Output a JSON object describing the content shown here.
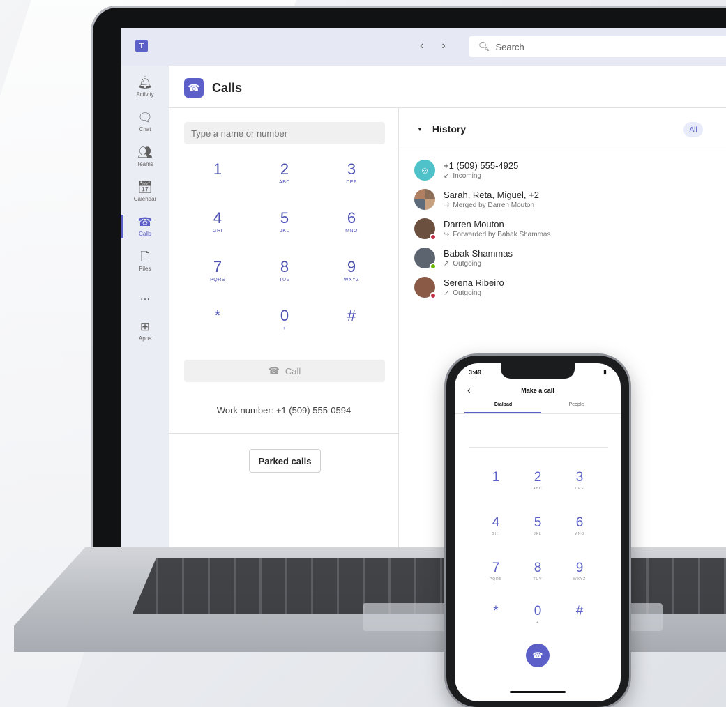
{
  "colors": {
    "brand": "#5b5fc7",
    "presence_busy": "#c4314b",
    "presence_available": "#6bb700"
  },
  "titlebar": {
    "back_icon": "chevron-left-icon",
    "forward_icon": "chevron-right-icon",
    "search_placeholder": "Search"
  },
  "rail": {
    "items": [
      {
        "label": "Activity",
        "icon": "bell-icon"
      },
      {
        "label": "Chat",
        "icon": "chat-icon"
      },
      {
        "label": "Teams",
        "icon": "teams-icon"
      },
      {
        "label": "Calendar",
        "icon": "calendar-icon"
      },
      {
        "label": "Calls",
        "icon": "phone-icon"
      },
      {
        "label": "Files",
        "icon": "file-icon"
      },
      {
        "label": "...",
        "icon": "more-icon"
      },
      {
        "label": "Apps",
        "icon": "apps-icon"
      }
    ]
  },
  "calls": {
    "title": "Calls",
    "dial_placeholder": "Type a name or number",
    "keypad": [
      {
        "digit": "1",
        "letters": ""
      },
      {
        "digit": "2",
        "letters": "ABC"
      },
      {
        "digit": "3",
        "letters": "DEF"
      },
      {
        "digit": "4",
        "letters": "GHI"
      },
      {
        "digit": "5",
        "letters": "JKL"
      },
      {
        "digit": "6",
        "letters": "MNO"
      },
      {
        "digit": "7",
        "letters": "PQRS"
      },
      {
        "digit": "8",
        "letters": "TUV"
      },
      {
        "digit": "9",
        "letters": "WXYZ"
      },
      {
        "digit": "*",
        "letters": ""
      },
      {
        "digit": "0",
        "letters": "+"
      },
      {
        "digit": "#",
        "letters": ""
      }
    ],
    "call_label": "Call",
    "work_number": "Work number: +1 (509) 555-0594",
    "parked_label": "Parked calls"
  },
  "history": {
    "title": "History",
    "filter": "All",
    "items": [
      {
        "name": "+1 (509) 555-4925",
        "detail": "Incoming",
        "status": ""
      },
      {
        "name": "Sarah, Reta, Miguel, +2",
        "detail": "Merged by Darren Mouton",
        "status": ""
      },
      {
        "name": "Darren Mouton",
        "detail": "Forwarded by Babak Shammas",
        "status": "busy"
      },
      {
        "name": "Babak Shammas",
        "detail": "Outgoing",
        "status": "available"
      },
      {
        "name": "Serena Ribeiro",
        "detail": "Outgoing",
        "status": "busy"
      }
    ]
  },
  "phone": {
    "time": "3:49",
    "title": "Make a call",
    "tabs": [
      "Dialpad",
      "People"
    ],
    "keypad": [
      {
        "digit": "1",
        "letters": ""
      },
      {
        "digit": "2",
        "letters": "ABC"
      },
      {
        "digit": "3",
        "letters": "DEF"
      },
      {
        "digit": "4",
        "letters": "GHI"
      },
      {
        "digit": "5",
        "letters": "JKL"
      },
      {
        "digit": "6",
        "letters": "MNO"
      },
      {
        "digit": "7",
        "letters": "PQRS"
      },
      {
        "digit": "8",
        "letters": "TUV"
      },
      {
        "digit": "9",
        "letters": "WXYZ"
      },
      {
        "digit": "*",
        "letters": ""
      },
      {
        "digit": "0",
        "letters": "+"
      },
      {
        "digit": "#",
        "letters": ""
      }
    ]
  }
}
